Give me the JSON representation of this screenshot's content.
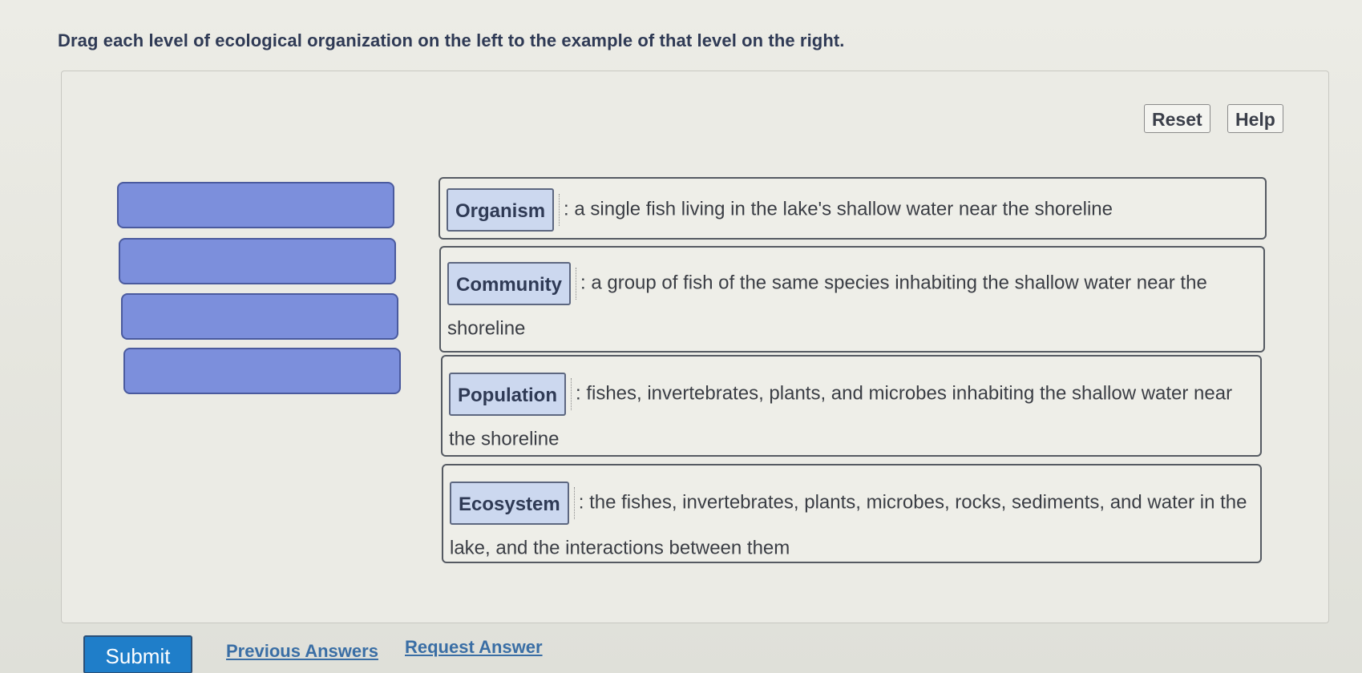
{
  "prompt": "Drag each level of ecological organization on the left to the example of that level on the right.",
  "toolbar": {
    "reset_label": "Reset",
    "help_label": "Help"
  },
  "source_slots": [
    {
      "label": ""
    },
    {
      "label": ""
    },
    {
      "label": ""
    },
    {
      "label": ""
    }
  ],
  "targets": [
    {
      "chip": "Organism",
      "description": ": a single fish living in the lake's shallow water near the shoreline"
    },
    {
      "chip": "Community",
      "description": ": a group of fish of the same species inhabiting the shallow water near the shoreline"
    },
    {
      "chip": "Population",
      "description": ": fishes, invertebrates, plants, and microbes inhabiting the shallow water near the shoreline"
    },
    {
      "chip": "Ecosystem",
      "description": ": the fishes, invertebrates, plants, microbes, rocks, sediments, and water in the lake, and the interactions between them"
    }
  ],
  "footer": {
    "submit_label": "Submit",
    "previous_answers_label": "Previous Answers",
    "request_answer_label": "Request Answer"
  },
  "colors": {
    "slot_fill": "#7c8fdc",
    "chip_fill": "#ccd8ef",
    "submit_fill": "#1f7ec9",
    "link": "#3a6ea5"
  }
}
